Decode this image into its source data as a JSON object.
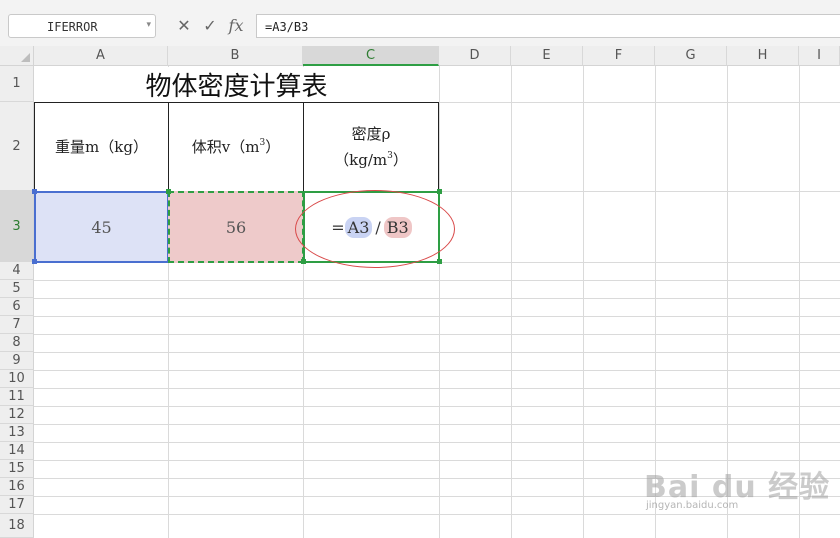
{
  "formula_bar": {
    "name_box": "IFERROR",
    "cancel_icon": "✕",
    "confirm_icon": "✓",
    "fx_label": "fx",
    "formula": "=A3/B3"
  },
  "columns": [
    "A",
    "B",
    "C",
    "D",
    "E",
    "F",
    "G",
    "H",
    "I"
  ],
  "rows": [
    "1",
    "2",
    "3",
    "4",
    "5",
    "6",
    "7",
    "8",
    "9",
    "10",
    "11",
    "12",
    "13",
    "14",
    "15",
    "16",
    "17",
    "18"
  ],
  "sheet": {
    "title": "物体密度计算表",
    "headers": {
      "weight": "重量m（kg）",
      "volume_prefix": "体积v（m",
      "volume_sup": "3",
      "volume_suffix": "）",
      "density_line1": "密度ρ",
      "density_line2_prefix": "（kg/m",
      "density_line2_sup": "3",
      "density_line2_suffix": "）"
    },
    "values": {
      "a3": "45",
      "b3": "56"
    },
    "c3_formula": {
      "eq": "=",
      "ref_a": "A3",
      "slash": "/",
      "ref_b": "B3"
    }
  },
  "colors": {
    "accent_green": "#2e9e44",
    "ref_blue": "#4a6fd0",
    "ref_red": "#d94a4a"
  },
  "watermark": {
    "text": "Bai du 经验",
    "sub": "jingyan.baidu.com"
  }
}
